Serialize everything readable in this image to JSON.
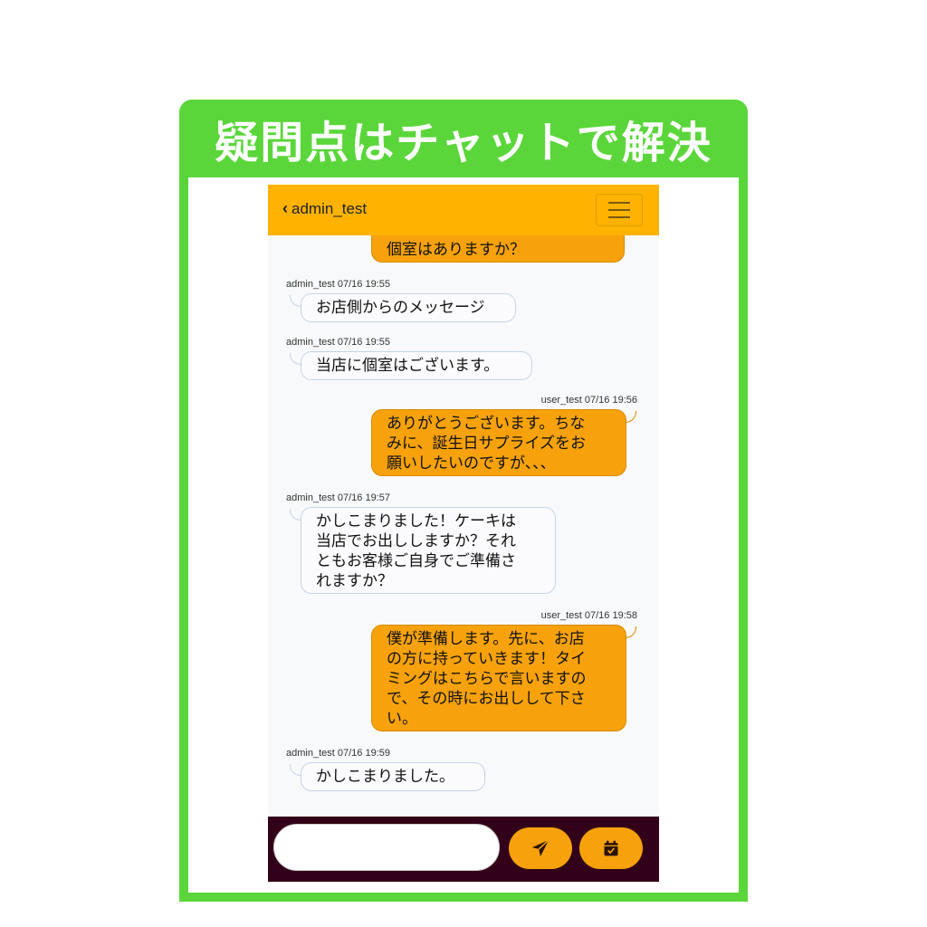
{
  "banner": {
    "title": "疑問点はチャットで解決"
  },
  "header": {
    "back_icon": "chevron-left-icon",
    "username": "admin_test",
    "menu_icon": "hamburger-menu-icon"
  },
  "messages": [
    {
      "side": "right",
      "meta": "",
      "text": "個室はありますか？"
    },
    {
      "side": "left",
      "meta": "admin_test 07/16 19:55",
      "text": "お店側からのメッセージ"
    },
    {
      "side": "left",
      "meta": "admin_test 07/16 19:55",
      "text": "当店に個室はございます。"
    },
    {
      "side": "right",
      "meta": "user_test 07/16 19:56",
      "text": "ありがとうございます。ちなみに、誕生日サプライズをお願いしたいのですが、、、"
    },
    {
      "side": "left",
      "meta": "admin_test 07/16 19:57",
      "text": "かしこまりました！ケーキは当店でお出ししますか？それともお客様ご自身でご準備されますか？"
    },
    {
      "side": "right",
      "meta": "user_test 07/16 19:58",
      "text": "僕が準備します。先に、お店の方に持っていきます！タイミングはこちらで言いますので、その時にお出しして下さい。"
    },
    {
      "side": "left",
      "meta": "admin_test 07/16 19:59",
      "text": "かしこまりました。"
    }
  ],
  "message_lines": {
    "m0": [
      "個室はありますか？"
    ],
    "m3": [
      "ありがとうございます。ちな",
      "みに、誕生日サプライズをお",
      "願いしたいのですが、、、"
    ],
    "m4": [
      "かしこまりました！ケーキは",
      "当店でお出ししますか？それ",
      "ともお客様ご自身でご準備さ",
      "れますか？"
    ],
    "m5": [
      "僕が準備します。先に、お店",
      "の方に持っていきます！タイ",
      "ミングはこちらで言いますの",
      "で、その時にお出しして下さ",
      "い。"
    ]
  },
  "composer": {
    "input_value": "",
    "send_icon": "paper-plane-icon",
    "calendar_icon": "calendar-check-icon"
  },
  "colors": {
    "frame_green": "#5ad63a",
    "header_orange": "#ffb300",
    "user_bubble": "#f7a20c",
    "bottom_bar": "#330019"
  }
}
